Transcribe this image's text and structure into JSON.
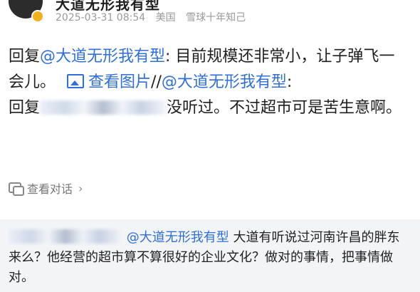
{
  "post": {
    "username": "大道无形我有型",
    "timestamp": "2025-03-31 08:54",
    "location": "美国",
    "source": "雪球十年知己"
  },
  "content": {
    "reply_prefix": "回复",
    "mention": "@大道无形我有型",
    "text_1": ": 目前规模还非常小，让子弹飞一会儿。",
    "view_images": "查看图片",
    "separator": "//",
    "mention_2": "@大道无形我有型",
    "text_2": ":",
    "reply_prefix_2": "回复",
    "text_3": "没听过。不过超市可是苦生意啊。"
  },
  "conversation": {
    "label": "查看对话",
    "chevron": "›"
  },
  "quote": {
    "mention": "@大道无形我有型",
    "text": " 大道有听说过河南许昌的胖东来么？他经营的超市算不算很好的企业文化？做对的事情，把事情做对。"
  },
  "colors": {
    "accent": "#2f6fd6",
    "meta": "#9a9a9a",
    "quote_bg": "#f3f4f6"
  },
  "icons": {
    "image": "image-icon",
    "conversation": "conversation-icon",
    "chevron": "chevron-right-icon"
  }
}
